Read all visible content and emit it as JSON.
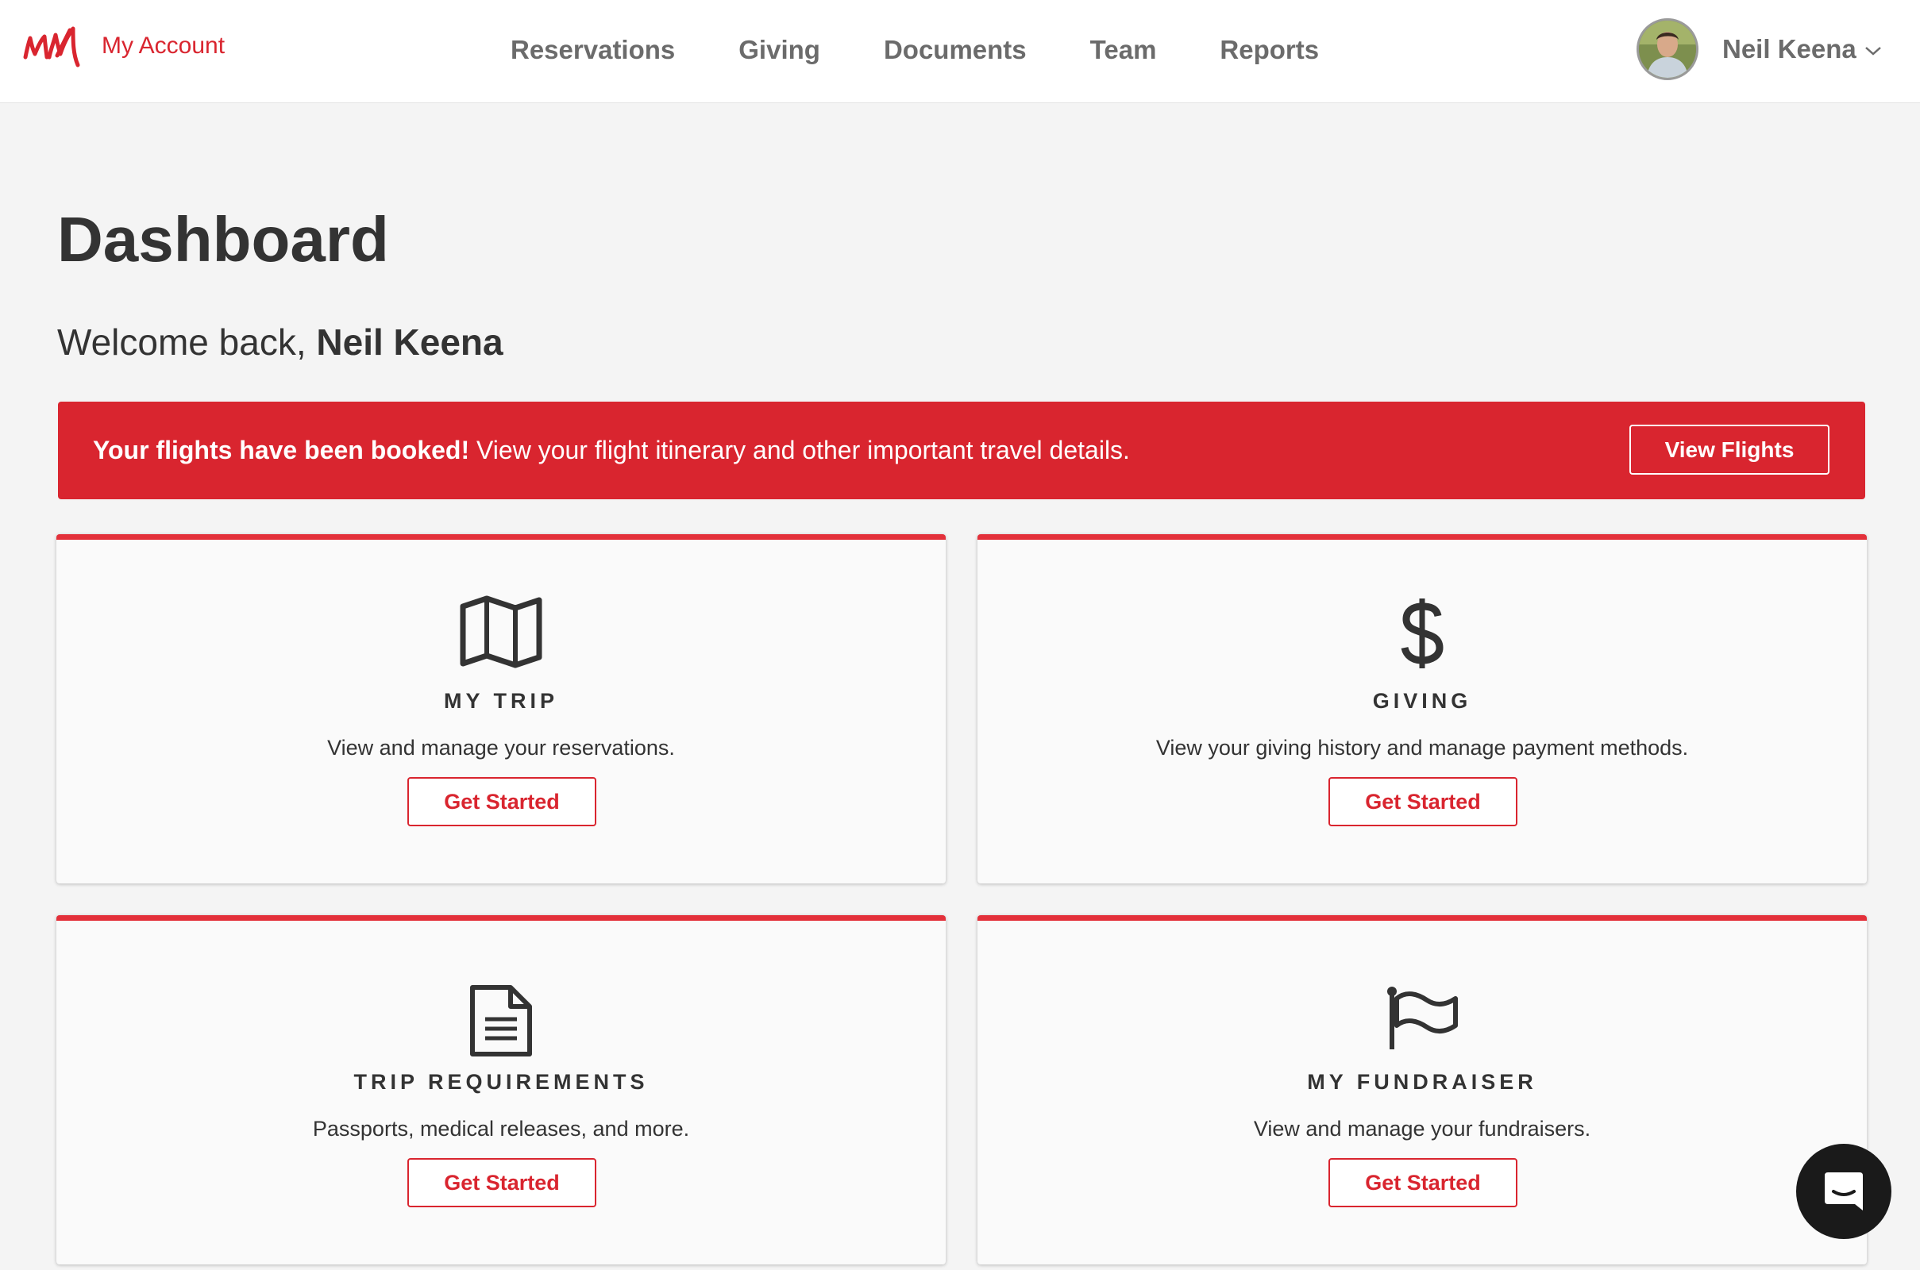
{
  "header": {
    "logo_alt": "MM",
    "app_label": "My Account",
    "nav": [
      "Reservations",
      "Giving",
      "Documents",
      "Team",
      "Reports"
    ],
    "user_name": "Neil Keena"
  },
  "main": {
    "title": "Dashboard",
    "welcome_prefix": "Welcome back,",
    "welcome_name": "Neil Keena",
    "alert": {
      "bold": "Your flights have been booked!",
      "text": " View your flight itinerary and other important travel details.",
      "button": "View Flights"
    },
    "cards": [
      {
        "icon": "map-icon",
        "title": "MY TRIP",
        "desc": "View and manage your reservations.",
        "button": "Get Started"
      },
      {
        "icon": "dollar-icon",
        "title": "GIVING",
        "desc": "View your giving history and manage payment methods.",
        "button": "Get Started"
      },
      {
        "icon": "document-icon",
        "title": "TRIP REQUIREMENTS",
        "desc": "Passports, medical releases, and more.",
        "button": "Get Started"
      },
      {
        "icon": "flag-icon",
        "title": "MY FUNDRAISER",
        "desc": "View and manage your fundraisers.",
        "button": "Get Started"
      }
    ]
  },
  "colors": {
    "brand_red": "#d9252f",
    "card_accent": "#e3303a",
    "text_dark": "#333333",
    "nav_gray": "#6b6b6b",
    "background": "#f4f4f4"
  },
  "chat_widget": {
    "icon": "chat-icon"
  }
}
